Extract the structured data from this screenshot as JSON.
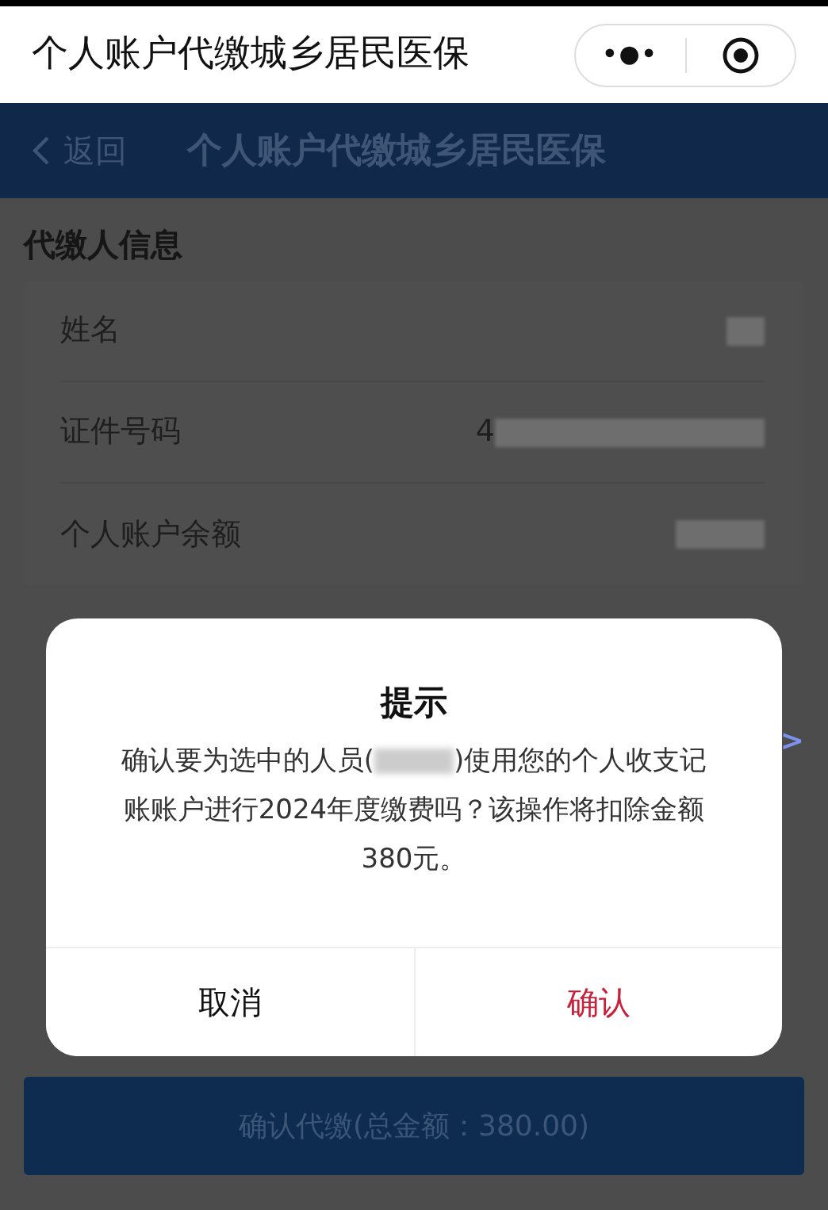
{
  "mini_program_bar": {
    "title": "个人账户代缴城乡居民医保",
    "more_glyph": "•●•"
  },
  "nav_bar": {
    "back": "返回",
    "title": "个人账户代缴城乡居民医保"
  },
  "payer_section": {
    "title": "代缴人信息",
    "rows": [
      {
        "label": "姓名",
        "blurred": true
      },
      {
        "label": "证件号码",
        "value_visible": "4",
        "blurred": true
      },
      {
        "label": "个人账户余额",
        "blurred": true
      }
    ]
  },
  "second_section": {
    "chevron": ">"
  },
  "submit_button": {
    "label": "确认代缴(总金额：380.00)"
  },
  "dialog": {
    "title": "提示",
    "message_before": "确认要为选中的人员(",
    "message_after": ")使用您的个人收支记账账户进行2024年度缴费吗？该操作将扣除金额380元。",
    "name_blurred": true,
    "buttons": [
      {
        "label": "取消",
        "kind": "cancel"
      },
      {
        "label": "确认",
        "kind": "confirm"
      }
    ]
  }
}
